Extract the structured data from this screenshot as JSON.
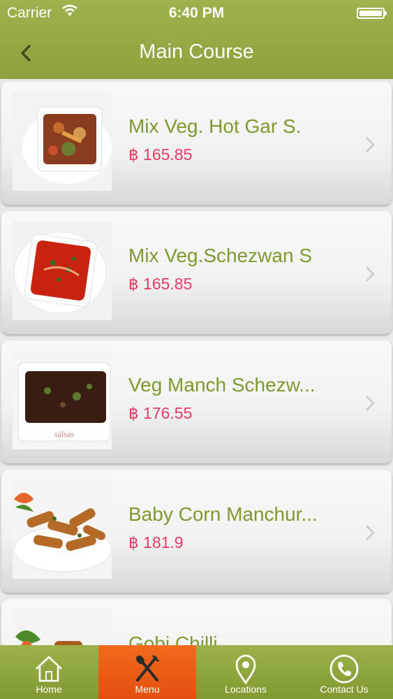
{
  "status_bar": {
    "carrier": "Carrier",
    "time": "6:40 PM"
  },
  "nav": {
    "title": "Main Course"
  },
  "items": [
    {
      "name": "Mix Veg. Hot Gar S.",
      "price": "฿ 165.85"
    },
    {
      "name": "Mix Veg.Schezwan S",
      "price": "฿ 165.85"
    },
    {
      "name": "Veg Manch Schezw...",
      "price": "฿ 176.55"
    },
    {
      "name": "Baby Corn Manchur...",
      "price": "฿ 181.9"
    },
    {
      "name": "Gobi Chilli",
      "price": ""
    }
  ],
  "tabs": [
    {
      "label": "Home",
      "icon": "home-icon"
    },
    {
      "label": "Menu",
      "icon": "fork-spoon-icon"
    },
    {
      "label": "Locations",
      "icon": "location-pin-icon"
    },
    {
      "label": "Contact Us",
      "icon": "phone-icon"
    }
  ],
  "colors": {
    "header": "#8fa640",
    "accent_orange": "#ec5c14",
    "item_name": "#7c9a2e",
    "price": "#e43c62"
  }
}
